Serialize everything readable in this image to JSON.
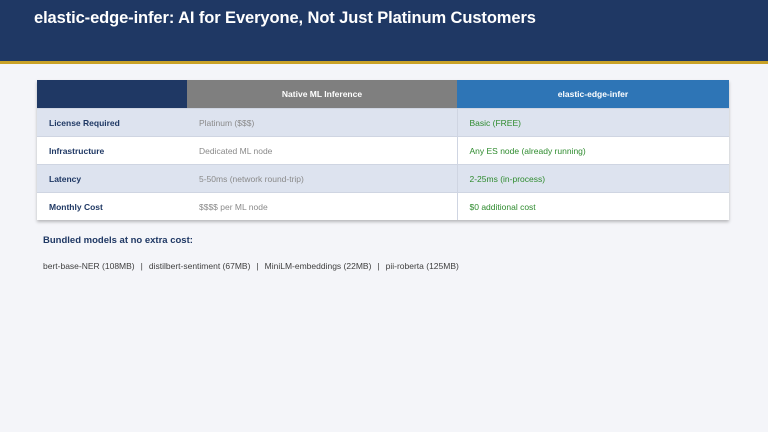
{
  "header": {
    "title": "elastic-edge-infer: AI for Everyone, Not Just Platinum Customers"
  },
  "table": {
    "columns": [
      "",
      "Native ML Inference",
      "elastic-edge-infer"
    ],
    "rows": [
      [
        "License Required",
        "Platinum ($$$)",
        "Basic (FREE)"
      ],
      [
        "Infrastructure",
        "Dedicated ML node",
        "Any ES node (already running)"
      ],
      [
        "Latency",
        "5-50ms (network round-trip)",
        "2-25ms (in-process)"
      ],
      [
        "Monthly Cost",
        "$$$$ per ML node",
        "$0 additional cost"
      ]
    ]
  },
  "bundled": {
    "title": "Bundled models at no extra cost:",
    "models": [
      "bert-base-NER (108MB)",
      "distilbert-sentiment (67MB)",
      "MiniLM-embeddings (22MB)",
      "pii-roberta (125MB)"
    ],
    "separator": "|"
  }
}
